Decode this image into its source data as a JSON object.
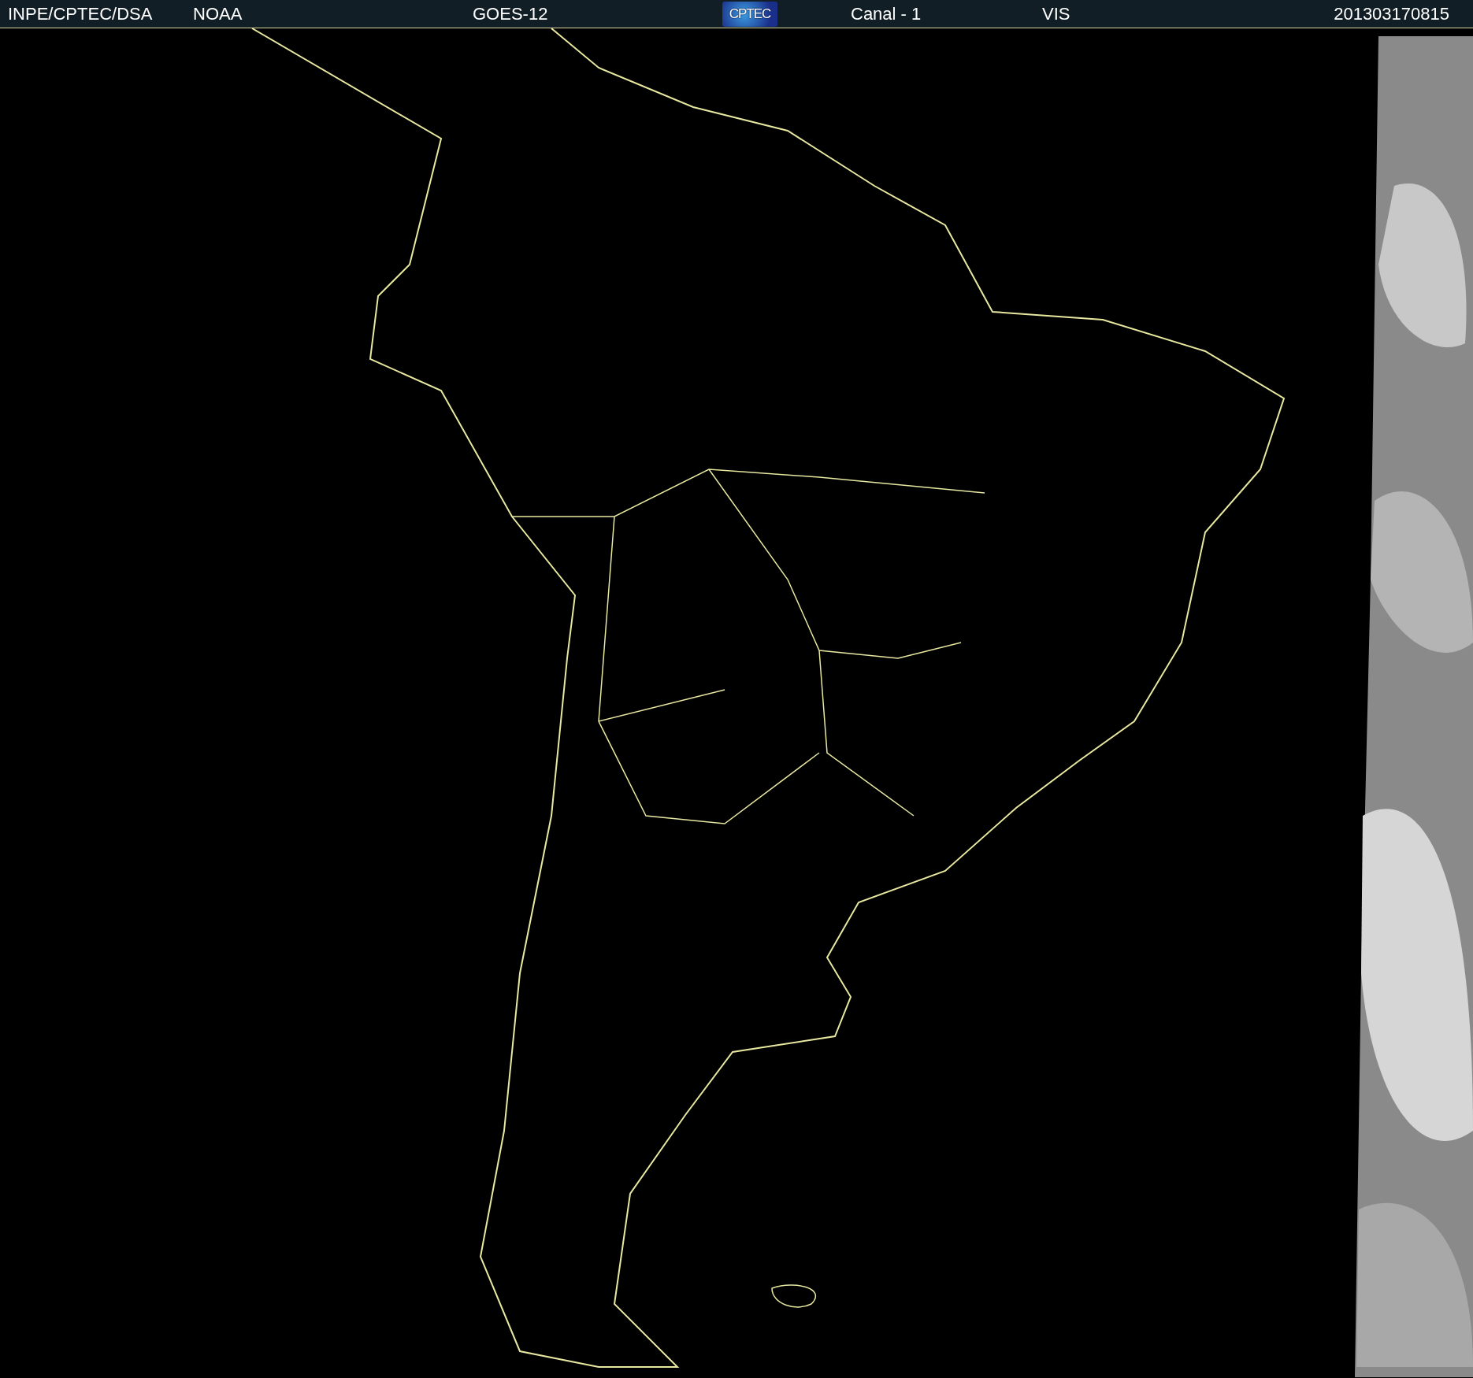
{
  "header": {
    "source": "INPE/CPTEC/DSA",
    "agency": "NOAA",
    "satellite": "GOES-12",
    "logo": "CPTEC",
    "channel": "Canal - 1",
    "band": "VIS",
    "timestamp": "201303170815"
  }
}
